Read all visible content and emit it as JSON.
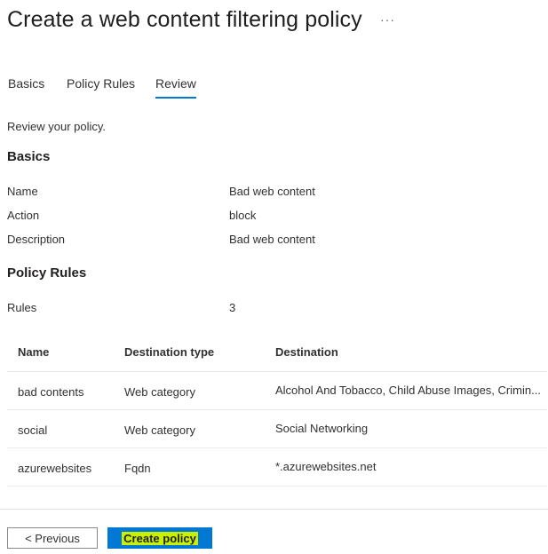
{
  "header": {
    "title": "Create a web content filtering policy",
    "more": "···"
  },
  "tabs": [
    {
      "label": "Basics"
    },
    {
      "label": "Policy Rules"
    },
    {
      "label": "Review",
      "active": true
    }
  ],
  "intro": "Review your policy.",
  "basics": {
    "heading": "Basics",
    "fields": [
      {
        "label": "Name",
        "value": "Bad web content"
      },
      {
        "label": "Action",
        "value": "block"
      },
      {
        "label": "Description",
        "value": "Bad web content"
      }
    ]
  },
  "policy_rules": {
    "heading": "Policy Rules",
    "rules_label": "Rules",
    "rules_value": "3"
  },
  "table": {
    "headers": [
      "Name",
      "Destination type",
      "Destination"
    ],
    "rows": [
      [
        "bad contents",
        "Web category",
        "Alcohol And Tobacco, Child Abuse Images, Crimin..."
      ],
      [
        "social",
        "Web category",
        "Social Networking"
      ],
      [
        "azurewebsites",
        "Fqdn",
        "*.azurewebsites.net"
      ]
    ]
  },
  "footer": {
    "previous_label": "< Previous",
    "create_label": "Create policy"
  },
  "colors": {
    "accent": "#0078d4",
    "highlight": "#c8f000"
  }
}
